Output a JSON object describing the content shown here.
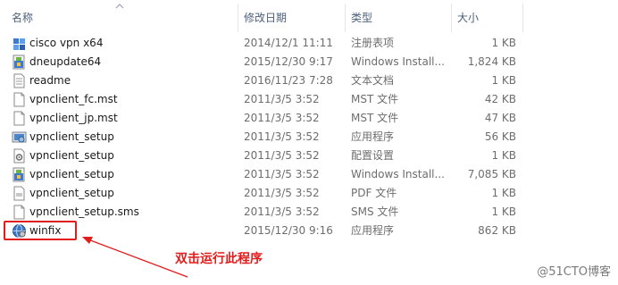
{
  "columns": {
    "name": "名称",
    "date": "修改日期",
    "type": "类型",
    "size": "大小"
  },
  "files": [
    {
      "name": "cisco vpn x64",
      "date": "2014/12/1 11:11",
      "type": "注册表项",
      "size": "1 KB",
      "icon": "registry-icon"
    },
    {
      "name": "dneupdate64",
      "date": "2015/12/30 9:17",
      "type": "Windows Install...",
      "size": "1,824 KB",
      "icon": "installer-icon"
    },
    {
      "name": "readme",
      "date": "2016/11/23 7:28",
      "type": "文本文档",
      "size": "1 KB",
      "icon": "text-file-icon"
    },
    {
      "name": "vpnclient_fc.mst",
      "date": "2011/3/5 3:52",
      "type": "MST 文件",
      "size": "42 KB",
      "icon": "blank-file-icon"
    },
    {
      "name": "vpnclient_jp.mst",
      "date": "2011/3/5 3:52",
      "type": "MST 文件",
      "size": "47 KB",
      "icon": "blank-file-icon"
    },
    {
      "name": "vpnclient_setup",
      "date": "2011/3/5 3:52",
      "type": "应用程序",
      "size": "56 KB",
      "icon": "setup-exe-icon"
    },
    {
      "name": "vpnclient_setup",
      "date": "2011/3/5 3:52",
      "type": "配置设置",
      "size": "1 KB",
      "icon": "config-file-icon"
    },
    {
      "name": "vpnclient_setup",
      "date": "2011/3/5 3:52",
      "type": "Windows Install...",
      "size": "7,085 KB",
      "icon": "installer-icon"
    },
    {
      "name": "vpnclient_setup",
      "date": "2011/3/5 3:52",
      "type": "PDF 文件",
      "size": "1 KB",
      "icon": "pdf-file-icon"
    },
    {
      "name": "vpnclient_setup.sms",
      "date": "2011/3/5 3:52",
      "type": "SMS 文件",
      "size": "1 KB",
      "icon": "blank-file-icon"
    },
    {
      "name": "winfix",
      "date": "2015/12/30 9:16",
      "type": "应用程序",
      "size": "862 KB",
      "icon": "globe-exe-icon"
    }
  ],
  "annotation": "双击运行此程序",
  "watermark": "@51CTO博客",
  "colors": {
    "annotation": "#e21b1b",
    "header_text": "#4c607a"
  }
}
